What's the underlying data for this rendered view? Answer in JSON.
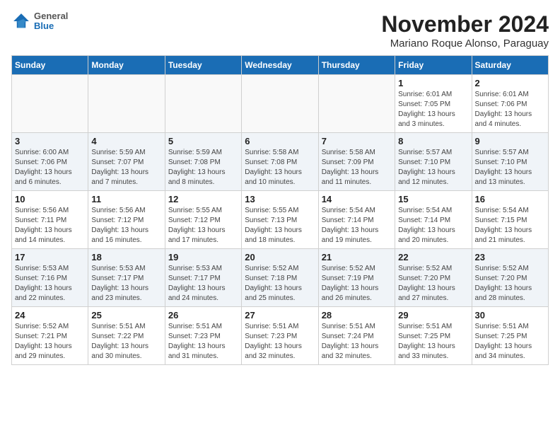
{
  "header": {
    "logo_line1": "General",
    "logo_line2": "Blue",
    "month_title": "November 2024",
    "subtitle": "Mariano Roque Alonso, Paraguay"
  },
  "days_of_week": [
    "Sunday",
    "Monday",
    "Tuesday",
    "Wednesday",
    "Thursday",
    "Friday",
    "Saturday"
  ],
  "weeks": [
    [
      {
        "day": "",
        "info": ""
      },
      {
        "day": "",
        "info": ""
      },
      {
        "day": "",
        "info": ""
      },
      {
        "day": "",
        "info": ""
      },
      {
        "day": "",
        "info": ""
      },
      {
        "day": "1",
        "info": "Sunrise: 6:01 AM\nSunset: 7:05 PM\nDaylight: 13 hours\nand 3 minutes."
      },
      {
        "day": "2",
        "info": "Sunrise: 6:01 AM\nSunset: 7:06 PM\nDaylight: 13 hours\nand 4 minutes."
      }
    ],
    [
      {
        "day": "3",
        "info": "Sunrise: 6:00 AM\nSunset: 7:06 PM\nDaylight: 13 hours\nand 6 minutes."
      },
      {
        "day": "4",
        "info": "Sunrise: 5:59 AM\nSunset: 7:07 PM\nDaylight: 13 hours\nand 7 minutes."
      },
      {
        "day": "5",
        "info": "Sunrise: 5:59 AM\nSunset: 7:08 PM\nDaylight: 13 hours\nand 8 minutes."
      },
      {
        "day": "6",
        "info": "Sunrise: 5:58 AM\nSunset: 7:08 PM\nDaylight: 13 hours\nand 10 minutes."
      },
      {
        "day": "7",
        "info": "Sunrise: 5:58 AM\nSunset: 7:09 PM\nDaylight: 13 hours\nand 11 minutes."
      },
      {
        "day": "8",
        "info": "Sunrise: 5:57 AM\nSunset: 7:10 PM\nDaylight: 13 hours\nand 12 minutes."
      },
      {
        "day": "9",
        "info": "Sunrise: 5:57 AM\nSunset: 7:10 PM\nDaylight: 13 hours\nand 13 minutes."
      }
    ],
    [
      {
        "day": "10",
        "info": "Sunrise: 5:56 AM\nSunset: 7:11 PM\nDaylight: 13 hours\nand 14 minutes."
      },
      {
        "day": "11",
        "info": "Sunrise: 5:56 AM\nSunset: 7:12 PM\nDaylight: 13 hours\nand 16 minutes."
      },
      {
        "day": "12",
        "info": "Sunrise: 5:55 AM\nSunset: 7:12 PM\nDaylight: 13 hours\nand 17 minutes."
      },
      {
        "day": "13",
        "info": "Sunrise: 5:55 AM\nSunset: 7:13 PM\nDaylight: 13 hours\nand 18 minutes."
      },
      {
        "day": "14",
        "info": "Sunrise: 5:54 AM\nSunset: 7:14 PM\nDaylight: 13 hours\nand 19 minutes."
      },
      {
        "day": "15",
        "info": "Sunrise: 5:54 AM\nSunset: 7:14 PM\nDaylight: 13 hours\nand 20 minutes."
      },
      {
        "day": "16",
        "info": "Sunrise: 5:54 AM\nSunset: 7:15 PM\nDaylight: 13 hours\nand 21 minutes."
      }
    ],
    [
      {
        "day": "17",
        "info": "Sunrise: 5:53 AM\nSunset: 7:16 PM\nDaylight: 13 hours\nand 22 minutes."
      },
      {
        "day": "18",
        "info": "Sunrise: 5:53 AM\nSunset: 7:17 PM\nDaylight: 13 hours\nand 23 minutes."
      },
      {
        "day": "19",
        "info": "Sunrise: 5:53 AM\nSunset: 7:17 PM\nDaylight: 13 hours\nand 24 minutes."
      },
      {
        "day": "20",
        "info": "Sunrise: 5:52 AM\nSunset: 7:18 PM\nDaylight: 13 hours\nand 25 minutes."
      },
      {
        "day": "21",
        "info": "Sunrise: 5:52 AM\nSunset: 7:19 PM\nDaylight: 13 hours\nand 26 minutes."
      },
      {
        "day": "22",
        "info": "Sunrise: 5:52 AM\nSunset: 7:20 PM\nDaylight: 13 hours\nand 27 minutes."
      },
      {
        "day": "23",
        "info": "Sunrise: 5:52 AM\nSunset: 7:20 PM\nDaylight: 13 hours\nand 28 minutes."
      }
    ],
    [
      {
        "day": "24",
        "info": "Sunrise: 5:52 AM\nSunset: 7:21 PM\nDaylight: 13 hours\nand 29 minutes."
      },
      {
        "day": "25",
        "info": "Sunrise: 5:51 AM\nSunset: 7:22 PM\nDaylight: 13 hours\nand 30 minutes."
      },
      {
        "day": "26",
        "info": "Sunrise: 5:51 AM\nSunset: 7:23 PM\nDaylight: 13 hours\nand 31 minutes."
      },
      {
        "day": "27",
        "info": "Sunrise: 5:51 AM\nSunset: 7:23 PM\nDaylight: 13 hours\nand 32 minutes."
      },
      {
        "day": "28",
        "info": "Sunrise: 5:51 AM\nSunset: 7:24 PM\nDaylight: 13 hours\nand 32 minutes."
      },
      {
        "day": "29",
        "info": "Sunrise: 5:51 AM\nSunset: 7:25 PM\nDaylight: 13 hours\nand 33 minutes."
      },
      {
        "day": "30",
        "info": "Sunrise: 5:51 AM\nSunset: 7:25 PM\nDaylight: 13 hours\nand 34 minutes."
      }
    ]
  ]
}
